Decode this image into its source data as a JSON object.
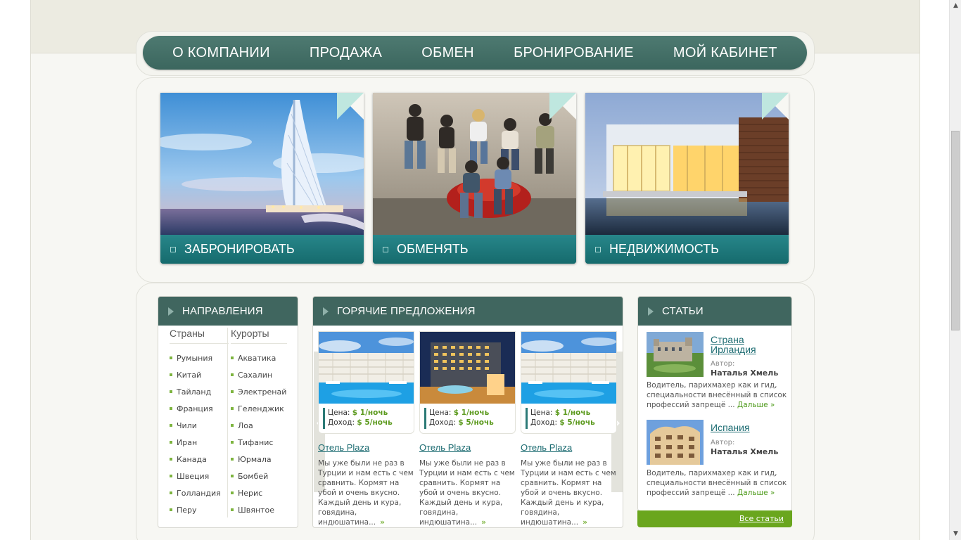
{
  "nav": {
    "items": [
      "О КОМПАНИИ",
      "ПРОДАЖА",
      "ОБМЕН",
      "БРОНИРОВАНИЕ",
      "МОЙ КАБИНЕТ"
    ]
  },
  "features": [
    {
      "label": "ЗАБРОНИРОВАТЬ"
    },
    {
      "label": "ОБМЕНЯТЬ"
    },
    {
      "label": "НЕДВИЖИМОСТЬ"
    }
  ],
  "directions": {
    "title": "НАПРАВЛЕНИЯ",
    "countries_title": "Страны",
    "resorts_title": "Курорты",
    "countries": [
      "Румыния",
      "Китай",
      "Тайланд",
      "Франция",
      "Чили",
      "Иран",
      "Канада",
      "Швеция",
      "Голландия",
      "Перу"
    ],
    "resorts": [
      "Акватика",
      "Сахалин",
      "Электренай",
      "Геленджик",
      "Лоа",
      "Тифанис",
      "Юрмала",
      "Бомбей",
      "Нерис",
      "Швянтое"
    ]
  },
  "hot": {
    "title": "ГОРЯЧИЕ ПРЕДЛОЖЕНИЯ",
    "prev_icon": "chevron-left-icon",
    "next_icon": "chevron-right-icon",
    "price_label": "Цена:",
    "income_label": "Доход:",
    "offers": [
      {
        "price": "$ 1/ночь",
        "income": "$ 5/ночь",
        "name": "Отель Plaza",
        "desc": "Мы уже были не раз в Турции и нам есть с чем сравнить. Кормят на убой и очень вкусно. Каждый день и кура, говядина, индюшатина..."
      },
      {
        "price": "$ 1/ночь",
        "income": "$ 5/ночь",
        "name": "Отель Plaza",
        "desc": "Мы уже были не раз в Турции и нам есть с чем сравнить. Кормят на убой и очень вкусно. Каждый день и кура, говядина, индюшатина..."
      },
      {
        "price": "$ 1/ночь",
        "income": "$ 5/ночь",
        "name": "Отель Plaza",
        "desc": "Мы уже были не раз в Турции и нам есть с чем сравнить. Кормят на убой и очень вкусно. Каждый день и кура, говядина, индюшатина..."
      }
    ],
    "more_symbol": "»"
  },
  "articles": {
    "title": "СТАТЬИ",
    "author_label": "Автор:",
    "items": [
      {
        "title": "Страна Ирландия",
        "author": "Наталья Хмель",
        "text": "Водитель, парихмахер как и гид, специальности внесённый в список профессий запрещё ...",
        "more": "Дальше »"
      },
      {
        "title": "Испания",
        "author": "Наталья Хмель",
        "text": "Водитель, парихмахер как и гид, специальности внесённый в список профессий запрещё ...",
        "more": "Дальше »"
      }
    ],
    "all_link": "Все статьи"
  },
  "colors": {
    "nav_bg": "#40665f",
    "accent_teal": "#1a7577",
    "accent_green": "#6aa61e"
  }
}
